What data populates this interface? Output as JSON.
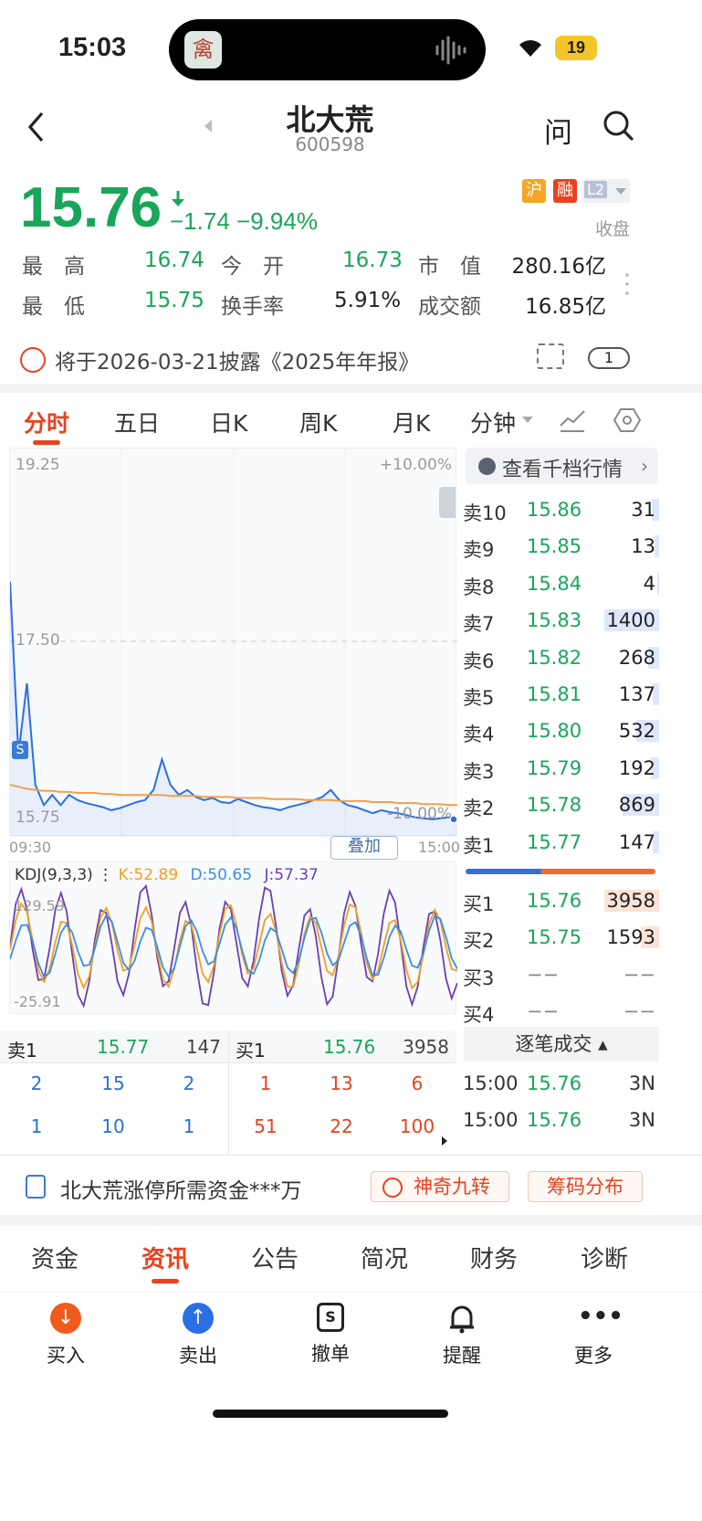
{
  "status": {
    "time": "15:03",
    "battery": "19"
  },
  "header": {
    "name": "北大荒",
    "code": "600598",
    "ask": "问"
  },
  "quote": {
    "price": "15.76",
    "change": "−1.74",
    "pct": "−9.94%",
    "badges": [
      "沪",
      "融",
      "L2"
    ],
    "state": "收盘"
  },
  "stats": [
    {
      "l1": "最　高",
      "v1": "16.74",
      "l2": "今　开",
      "v2": "16.73",
      "l3": "市　值",
      "v3": "280.16亿"
    },
    {
      "l1": "最　低",
      "v1": "15.75",
      "l2": "换手率",
      "v2": "5.91%",
      "l3": "成交额",
      "v3": "16.85亿"
    }
  ],
  "notice": {
    "text": "将于2026-03-21披露《2025年年报》",
    "count": "1"
  },
  "tabs": [
    "分时",
    "五日",
    "日K",
    "周K",
    "月K",
    "分钟"
  ],
  "chart": {
    "y_top": "19.25",
    "y_mid": "17.50",
    "y_bot": "15.75",
    "pct_top": "+10.00%",
    "pct_bot": "-10.00%",
    "t_start": "09:30",
    "t_end": "15:00",
    "overlay": "叠加",
    "marker": "S"
  },
  "kdj": {
    "label": "KDJ(9,3,3)",
    "k": "K:52.89",
    "d": "D:50.65",
    "j": "J:57.37",
    "top": "129.59",
    "bot": "-25.91"
  },
  "chart_data": {
    "type": "line",
    "x_range": [
      "09:30",
      "15:00"
    ],
    "ylim": [
      15.75,
      19.25
    ],
    "series": [
      {
        "values": [
          18.1,
          16.4,
          17.1,
          16.1,
          15.9,
          16.0,
          15.9,
          16.0,
          15.95,
          15.92,
          15.9,
          15.88,
          15.85,
          15.87,
          15.9,
          15.93,
          15.95,
          16.05,
          16.35,
          16.1,
          16.0,
          16.05,
          15.98,
          15.95,
          15.97,
          15.93,
          15.92,
          15.96,
          15.93,
          15.9,
          15.88,
          15.87,
          15.85,
          15.88,
          15.9,
          15.92,
          15.95,
          15.98,
          16.05,
          15.95,
          15.9,
          15.88,
          15.85,
          15.82,
          15.85,
          15.83,
          15.82,
          15.8,
          15.78,
          15.77,
          15.76,
          15.77,
          15.78,
          15.76
        ]
      },
      {
        "values": [
          16.1,
          16.08,
          16.06,
          16.05,
          16.04,
          16.04,
          16.03,
          16.03,
          16.02,
          16.02,
          16.02,
          16.01,
          16.01,
          16.0,
          16.0,
          16.0,
          16.0,
          16.0,
          16.0,
          15.99,
          15.99,
          15.99,
          15.99,
          15.98,
          15.98,
          15.98,
          15.98,
          15.97,
          15.97,
          15.97,
          15.97,
          15.96,
          15.96,
          15.96,
          15.96,
          15.95,
          15.95,
          15.95,
          15.95,
          15.94,
          15.94,
          15.94,
          15.94,
          15.93,
          15.93,
          15.93,
          15.92,
          15.92,
          15.92,
          15.91,
          15.91,
          15.91,
          15.9,
          15.9
        ]
      }
    ]
  },
  "asks": [
    {
      "l": "卖10",
      "p": "15.86",
      "v": "31"
    },
    {
      "l": "卖9",
      "p": "15.85",
      "v": "13"
    },
    {
      "l": "卖8",
      "p": "15.84",
      "v": "4"
    },
    {
      "l": "卖7",
      "p": "15.83",
      "v": "1400"
    },
    {
      "l": "卖6",
      "p": "15.82",
      "v": "268"
    },
    {
      "l": "卖5",
      "p": "15.81",
      "v": "137"
    },
    {
      "l": "卖4",
      "p": "15.80",
      "v": "532"
    },
    {
      "l": "卖3",
      "p": "15.79",
      "v": "192"
    },
    {
      "l": "卖2",
      "p": "15.78",
      "v": "869"
    },
    {
      "l": "卖1",
      "p": "15.77",
      "v": "147"
    }
  ],
  "bids": [
    {
      "l": "买1",
      "p": "15.76",
      "v": "3958"
    },
    {
      "l": "买2",
      "p": "15.75",
      "v": "1593"
    },
    {
      "l": "买3",
      "p": "−−",
      "v": "−−"
    },
    {
      "l": "买4",
      "p": "−−",
      "v": "−−"
    }
  ],
  "depth_btn": "查看千档行情",
  "ticks_title": "逐笔成交",
  "ticks": [
    {
      "t": "15:00",
      "p": "15.76",
      "v": "3N"
    },
    {
      "t": "15:00",
      "p": "15.76",
      "v": "3N"
    }
  ],
  "queue": {
    "sell_l": "卖1",
    "sell_p": "15.77",
    "sell_v": "147",
    "buy_l": "买1",
    "buy_p": "15.76",
    "buy_v": "3958",
    "sell_rows": [
      [
        "2",
        "15",
        "2"
      ],
      [
        "1",
        "10",
        "1"
      ]
    ],
    "buy_rows": [
      [
        "1",
        "13",
        "6"
      ],
      [
        "51",
        "22",
        "100"
      ]
    ]
  },
  "promo": {
    "text": "北大荒涨停所需资金***万",
    "b1": "神奇九转",
    "b2": "筹码分布"
  },
  "info_tabs": [
    "资金",
    "资讯",
    "公告",
    "简况",
    "财务",
    "诊断"
  ],
  "bottom": [
    {
      "icon": "buy-icon",
      "label": "买入"
    },
    {
      "icon": "sell-icon",
      "label": "卖出"
    },
    {
      "icon": "cancel-order-icon",
      "label": "撤单"
    },
    {
      "icon": "bell-icon",
      "label": "提醒"
    },
    {
      "icon": "more-icon",
      "label": "更多"
    }
  ]
}
